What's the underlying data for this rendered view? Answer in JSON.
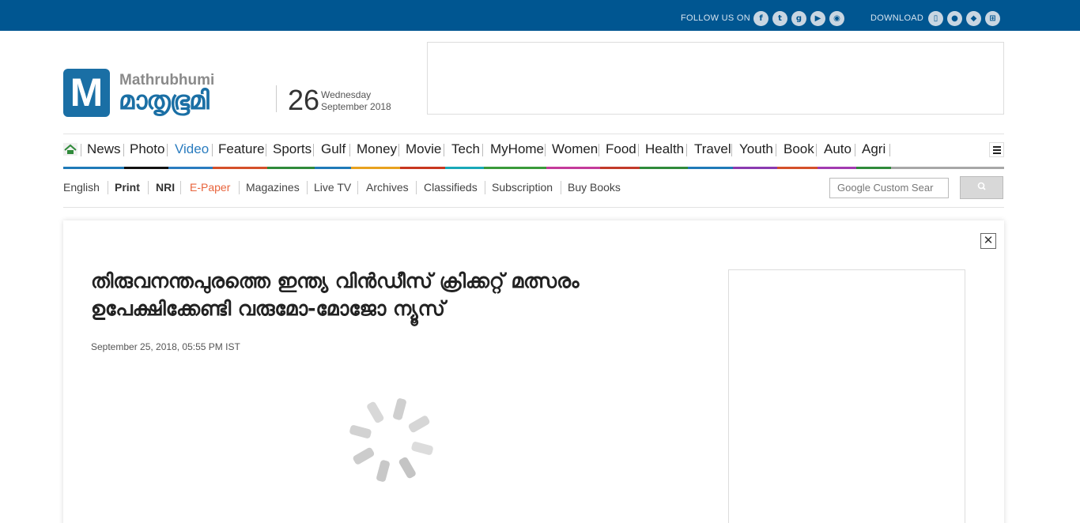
{
  "topbar": {
    "follow_label": "FOLLOW US ON",
    "social_icons": [
      "facebook-icon",
      "twitter-icon",
      "google-plus-icon",
      "youtube-icon",
      "rss-icon"
    ],
    "download_label": "DOWNLOAD",
    "app_icons": [
      "mobile-app-icon",
      "apple-app-icon",
      "android-app-icon",
      "windows-app-icon"
    ],
    "bg_color": "#005691"
  },
  "masthead": {
    "logo_letter": "M",
    "logo_en": "Mathrubhumi",
    "logo_ml": "മാതൃഭൂമി",
    "date_day": "26",
    "date_weekday": "Wednesday",
    "date_month_year": "September 2018"
  },
  "main_nav": {
    "home_icon": "home-icon",
    "items": [
      {
        "label": "News",
        "color": "#1f7ab8"
      },
      {
        "label": "Photo",
        "color": "#111111"
      },
      {
        "label": "Video",
        "color": "#2a7cbf",
        "active": true
      },
      {
        "label": "Feature",
        "color": "#d4502a"
      },
      {
        "label": "Sports",
        "color": "#2f8a3a"
      },
      {
        "label": "Gulf",
        "color": "#1f7ab8"
      },
      {
        "label": "Money",
        "color": "#e8a21f"
      },
      {
        "label": "Movie",
        "color": "#c8371f"
      },
      {
        "label": "Tech",
        "color": "#19a8b8"
      },
      {
        "label": "MyHome",
        "color": "#3a9a3a"
      },
      {
        "label": "Women",
        "color": "#c43b9a"
      },
      {
        "label": "Food",
        "color": "#c23a2a"
      },
      {
        "label": "Health",
        "color": "#2f8a3a"
      },
      {
        "label": "Travel",
        "color": "#1f7ab8"
      },
      {
        "label": "Youth",
        "color": "#8a3ab0"
      },
      {
        "label": "Book",
        "color": "#d4502a"
      },
      {
        "label": "Auto",
        "color": "#a23ab0"
      },
      {
        "label": "Agri",
        "color": "#2f8a3a"
      }
    ],
    "menu_icon": "hamburger-menu-icon"
  },
  "sub_nav": {
    "items": [
      {
        "label": "English",
        "style": "normal"
      },
      {
        "label": "Print",
        "style": "bold"
      },
      {
        "label": "NRI",
        "style": "bold"
      },
      {
        "label": "E-Paper",
        "style": "epaper"
      },
      {
        "label": "Magazines",
        "style": "normal"
      },
      {
        "label": "Live TV",
        "style": "normal"
      },
      {
        "label": "Archives",
        "style": "normal"
      },
      {
        "label": "Classifieds",
        "style": "normal"
      },
      {
        "label": "Subscription",
        "style": "normal"
      },
      {
        "label": "Buy Books",
        "style": "normal"
      }
    ],
    "search_placeholder": "Google Custom Sear",
    "search_icon": "search-icon",
    "epaper_color": "#e8643c"
  },
  "article": {
    "headline": "തിരുവനന്തപുരത്തെ ഇന്ത്യ വിൻഡീസ് ക്രിക്കറ്റ് മത്സരം ഉപേക്ഷിക്കേണ്ടി വരുമോ-മോജോ ന്യൂസ്",
    "timestamp": "September 25, 2018, 05:55 PM IST",
    "close_icon": "close-icon",
    "close_glyph": "✕",
    "loading_icon": "loading-spinner-icon"
  }
}
